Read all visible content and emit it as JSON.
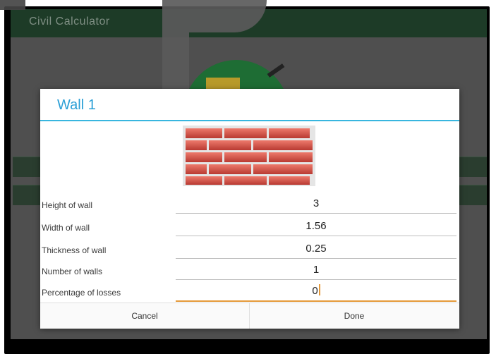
{
  "app": {
    "title": "Civil Calculator"
  },
  "dialog": {
    "title": "Wall 1",
    "fields": [
      {
        "label": "Height of wall",
        "value": "3"
      },
      {
        "label": "Width of wall",
        "value": "1.56"
      },
      {
        "label": "Thickness of wall",
        "value": "0.25"
      },
      {
        "label": "Number of walls",
        "value": "1"
      },
      {
        "label": "Percentage of losses",
        "value": "0"
      }
    ],
    "cancel_label": "Cancel",
    "done_label": "Done"
  },
  "colors": {
    "appbar": "#1d3b27",
    "accent": "#2a9fd6",
    "focus_underline": "#e59a3a",
    "brick": "#d9554a"
  },
  "icons": {
    "brick": "brick-wall-icon",
    "logo": "app-logo"
  }
}
